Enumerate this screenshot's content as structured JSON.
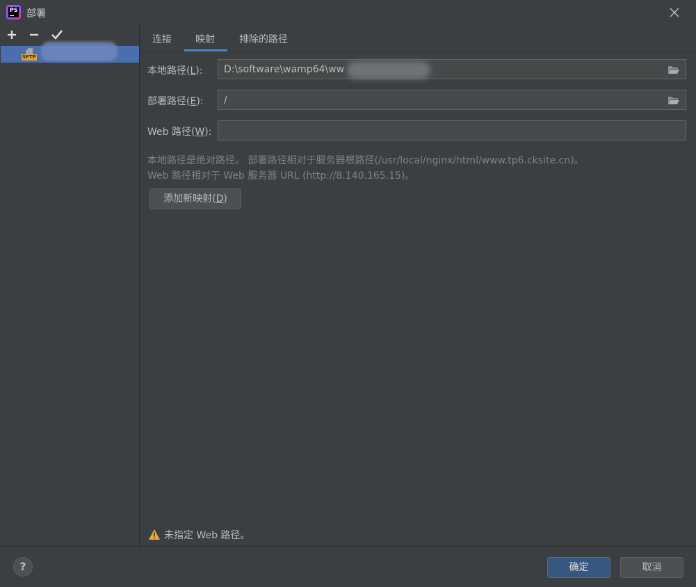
{
  "window": {
    "title": "部署",
    "app_icon_text": "PS"
  },
  "toolbar": {
    "add_label": "+",
    "remove_label": "−",
    "apply_label": "✔"
  },
  "servers": [
    {
      "badge": "SFTP",
      "name": ""
    }
  ],
  "tabs": [
    {
      "label": "连接",
      "active": false
    },
    {
      "label": "映射",
      "active": true
    },
    {
      "label": "排除的路径",
      "active": false
    }
  ],
  "mapping": {
    "local_path": {
      "label_prefix": "本地路径(",
      "mnemonic": "L",
      "label_suffix": "):",
      "value": "D:\\software\\wamp64\\ww"
    },
    "deploy_path": {
      "label_prefix": "部署路径(",
      "mnemonic": "E",
      "label_suffix": "):",
      "value": "/"
    },
    "web_path": {
      "label_prefix": "Web 路径(",
      "mnemonic": "W",
      "label_suffix": "):",
      "value": ""
    }
  },
  "hints": {
    "line1": "本地路径是绝对路径。 部署路径相对于服务器根路径(/usr/local/nginx/html/www.tp6.cksite.cn)。",
    "line2": "Web 路径相对于 Web 服务器 URL (http://8.140.165.15)。"
  },
  "add_mapping": {
    "label_prefix": "添加新映射(",
    "mnemonic": "D",
    "label_suffix": ")"
  },
  "warning": {
    "text": "未指定 Web 路径。",
    "icon": "warning-icon"
  },
  "footer": {
    "help_label": "?",
    "ok_label": "确定",
    "cancel_label": "取消"
  },
  "colors": {
    "background": "#3c3f41",
    "selection": "#4b6eaf",
    "tab_underline": "#4a88c7",
    "primary_button": "#365880",
    "warning": "#f0a732"
  }
}
